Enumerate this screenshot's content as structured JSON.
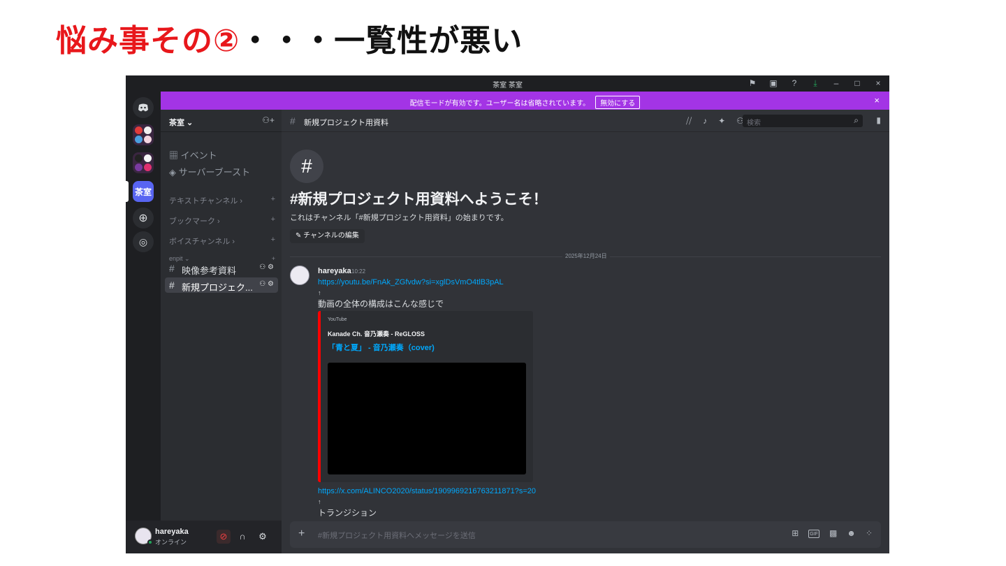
{
  "slide": {
    "title_red": "悩み事その②",
    "title_black": "・・・一覧性が悪い"
  },
  "window": {
    "title": "茶室 茶室"
  },
  "banner": {
    "message": "配信モードが有効です。ユーザー名は省略されています。",
    "disable_button": "無効にする",
    "close": "×"
  },
  "servers": {
    "active_label": "茶室"
  },
  "sidebar": {
    "guild_name": "茶室 ⌄",
    "items": [
      {
        "label": "イベント",
        "icon": "calendar-icon"
      },
      {
        "label": "サーバーブースト",
        "icon": "boost-icon"
      }
    ],
    "categories": [
      {
        "label": "テキストチャンネル ›"
      },
      {
        "label": "ブックマーク ›"
      },
      {
        "label": "ボイスチャンネル ›"
      },
      {
        "label": "enpit ⌄"
      }
    ],
    "channels": [
      {
        "label": "映像参考資料",
        "selected": false
      },
      {
        "label": "新規プロジェク...",
        "selected": true
      }
    ]
  },
  "user": {
    "name": "hareyaka",
    "status": "オンライン"
  },
  "channel_header": {
    "name": "新規プロジェクト用資料",
    "search_placeholder": "検索"
  },
  "welcome": {
    "title": "#新規プロジェクト用資料へようこそ！",
    "subtitle": "これはチャンネル「#新規プロジェクト用資料」の始まりです。",
    "edit_button": "✎ チャンネルの編集"
  },
  "date_divider": "2025年12月24日",
  "message": {
    "author": "hareyaka",
    "time": "10:22",
    "link1": "https://youtu.be/FnAk_ZGfvdw?si=xglDsVmO4tlB3pAL",
    "arrow": "↑",
    "text1": "動画の全体の構成はこんな感じで",
    "embed": {
      "provider": "YouTube",
      "author": "Kanade Ch. 音乃瀬奏 - ReGLOSS",
      "title": "「青と夏」 - 音乃瀬奏（cover)"
    },
    "link2": "https://x.com/ALINCO2020/status/1909969216763211871?s=20",
    "text2": "トランジション"
  },
  "composer": {
    "placeholder": "#新規プロジェクト用資料へメッセージを送信",
    "gif": "GIF"
  },
  "colors": {
    "title_red": "#e8171b",
    "banner": "#a334e5",
    "link": "#00a8fc",
    "accent": "#5865f2"
  }
}
